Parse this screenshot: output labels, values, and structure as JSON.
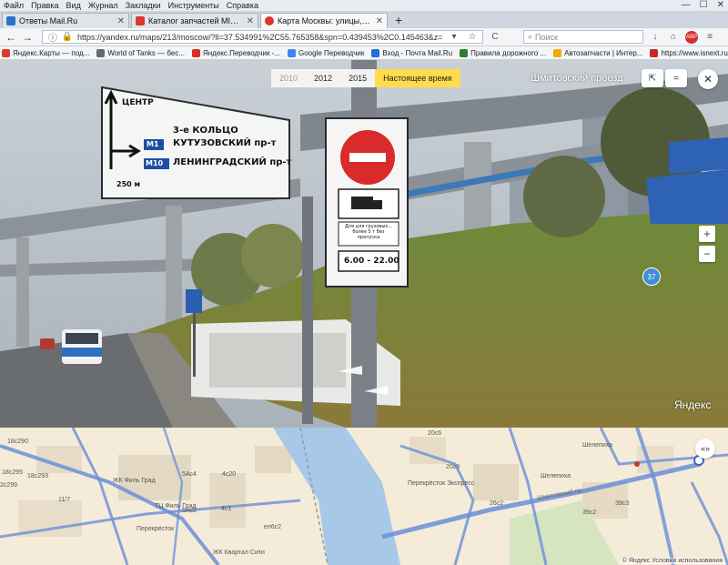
{
  "menu": [
    "Файл",
    "Правка",
    "Вид",
    "Журнал",
    "Закладки",
    "Инструменты",
    "Справка"
  ],
  "window_controls": [
    "—",
    "☐",
    "✕"
  ],
  "tabs": [
    {
      "label": "Ответы Mail.Ru",
      "favicon_color": "#2b73c9",
      "active": false
    },
    {
      "label": "Каталог запчастей MITSUBISHI",
      "favicon_color": "#d83a2f",
      "active": false
    },
    {
      "label": "Карта Москвы: улицы, дома...",
      "favicon_color": "#e0332b",
      "active": true
    }
  ],
  "new_tab_label": "+",
  "navbar": {
    "back": "←",
    "forward": "→",
    "info": "ⓘ",
    "url": "https://yandex.ru/maps/213/moscow/?ll=37.534991%2C55.765358&spn=0.439453%2C0.145463&z=1",
    "search_placeholder": "Поиск",
    "reload": "C",
    "star": "☆"
  },
  "bookmarks": [
    {
      "label": "Яндекс.Карты — под...",
      "color": "#e03a2f"
    },
    {
      "label": "World of Tanks — бес...",
      "color": "#6b6b6b"
    },
    {
      "label": "Яндекс.Переводчик -...",
      "color": "#d93025"
    },
    {
      "label": "Google Переводчик",
      "color": "#4285f4"
    },
    {
      "label": "Вход - Почта Mail.Ru",
      "color": "#1f6fd6"
    },
    {
      "label": "Правила дорожного ...",
      "color": "#2f7d32"
    },
    {
      "label": "Автозапчасти | Интер...",
      "color": "#f2a900"
    },
    {
      "label": "https://www.isnext.ru/",
      "color": "#c62828"
    }
  ],
  "panorama": {
    "years": [
      {
        "label": "2010",
        "state": "muted"
      },
      {
        "label": "2012",
        "state": "normal"
      },
      {
        "label": "2015",
        "state": "normal"
      },
      {
        "label": "Настоящее время",
        "state": "active"
      }
    ],
    "title": "Шмитовский проезд",
    "share_icon": "⇱",
    "menu_icon": "=",
    "close_icon": "✕",
    "zoom_in": "+",
    "zoom_out": "−",
    "route_badge": "37",
    "logo": "Яндекс",
    "sign_direction": {
      "line1": "ЦЕНТР",
      "line2": "3-е КОЛЬЦО",
      "route1_badge": "М1",
      "route1_name": "КУТУЗОВСКИЙ пр-т",
      "route2_badge": "М10",
      "route2_name": "ЛЕНИНГРАДСКИЙ пр-т",
      "distance": "250 м"
    },
    "sign_plate_text": "Для для грузовых... более 5 т без пропуска",
    "sign_hours": "6.00 - 22.00"
  },
  "map": {
    "labels": [
      {
        "text": "18c290",
        "street": false
      },
      {
        "text": "18c295",
        "street": false
      },
      {
        "text": "18c293",
        "street": false
      },
      {
        "text": "2c299",
        "street": false
      },
      {
        "text": "11/7",
        "street": false
      },
      {
        "text": "ЖК Филь Град",
        "street": false
      },
      {
        "text": "ТЦ Филь Град",
        "street": false
      },
      {
        "text": "5Ac4",
        "street": false
      },
      {
        "text": "5Ac2",
        "street": false
      },
      {
        "text": "4c20",
        "street": false
      },
      {
        "text": "4c1",
        "street": false
      },
      {
        "text": "Перекрёсток",
        "street": false
      },
      {
        "text": "ЖК Квартал Сити",
        "street": false
      },
      {
        "text": "20c6",
        "street": false
      },
      {
        "text": "20c9",
        "street": false
      },
      {
        "text": "Перекрёсток Экспресс",
        "street": false
      },
      {
        "text": "Шмитовский пр.",
        "street": true
      },
      {
        "text": "Шелепиха",
        "street": false
      },
      {
        "text": "Шелепиха",
        "street": false
      },
      {
        "text": "39c3",
        "street": false
      },
      {
        "text": "39c2",
        "street": false
      },
      {
        "text": "26c2",
        "street": false
      },
      {
        "text": "ел6c2",
        "street": false
      }
    ],
    "attribution": "© Яндекс  Условия использования",
    "expand_icon": "«»"
  }
}
